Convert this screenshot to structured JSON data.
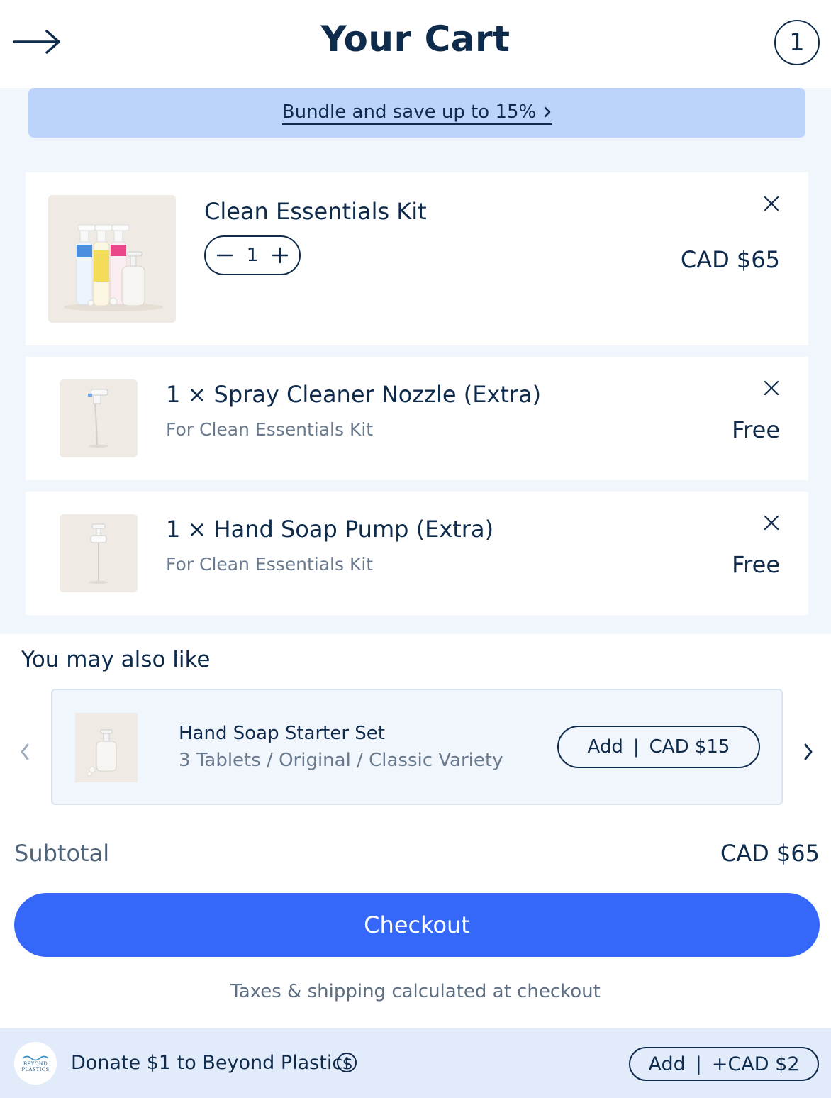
{
  "header": {
    "title": "Your Cart",
    "cart_count": "1",
    "back_icon": "arrow-right-icon"
  },
  "promo": {
    "label": "Bundle and save up to 15%",
    "icon": "chevron-right-icon"
  },
  "cart_items": [
    {
      "name": "Clean Essentials Kit",
      "quantity": "1",
      "price": "CAD $65",
      "remove_icon": "close-icon"
    },
    {
      "name": "1 × Spray Cleaner Nozzle (Extra)",
      "subtitle": "For Clean Essentials Kit",
      "price": "Free",
      "remove_icon": "close-icon"
    },
    {
      "name": "1 × Hand Soap Pump (Extra)",
      "subtitle": "For Clean Essentials Kit",
      "price": "Free",
      "remove_icon": "close-icon"
    }
  ],
  "recommendations": {
    "heading": "You may also like",
    "items": [
      {
        "name": "Hand Soap Starter Set",
        "variant": "3 Tablets / Original / Classic Variety",
        "add_label": "Add",
        "separator": "|",
        "price": "CAD $15"
      }
    ]
  },
  "summary": {
    "subtotal_label": "Subtotal",
    "subtotal_value": "CAD $65",
    "checkout_label": "Checkout",
    "tax_note": "Taxes & shipping calculated at checkout"
  },
  "donate": {
    "logo_line1": "BEYOND",
    "logo_line2": "PLASTICS",
    "text": "Donate $1 to Beyond Plastics",
    "add_label": "Add",
    "separator": "|",
    "price": "+CAD $2"
  },
  "colors": {
    "primary_text": "#0f2b4c",
    "accent_blue": "#3568f8",
    "banner_blue": "#bcd4fb",
    "zone_bg": "#f1f5fc",
    "footer_bg": "#e2ebfa"
  }
}
